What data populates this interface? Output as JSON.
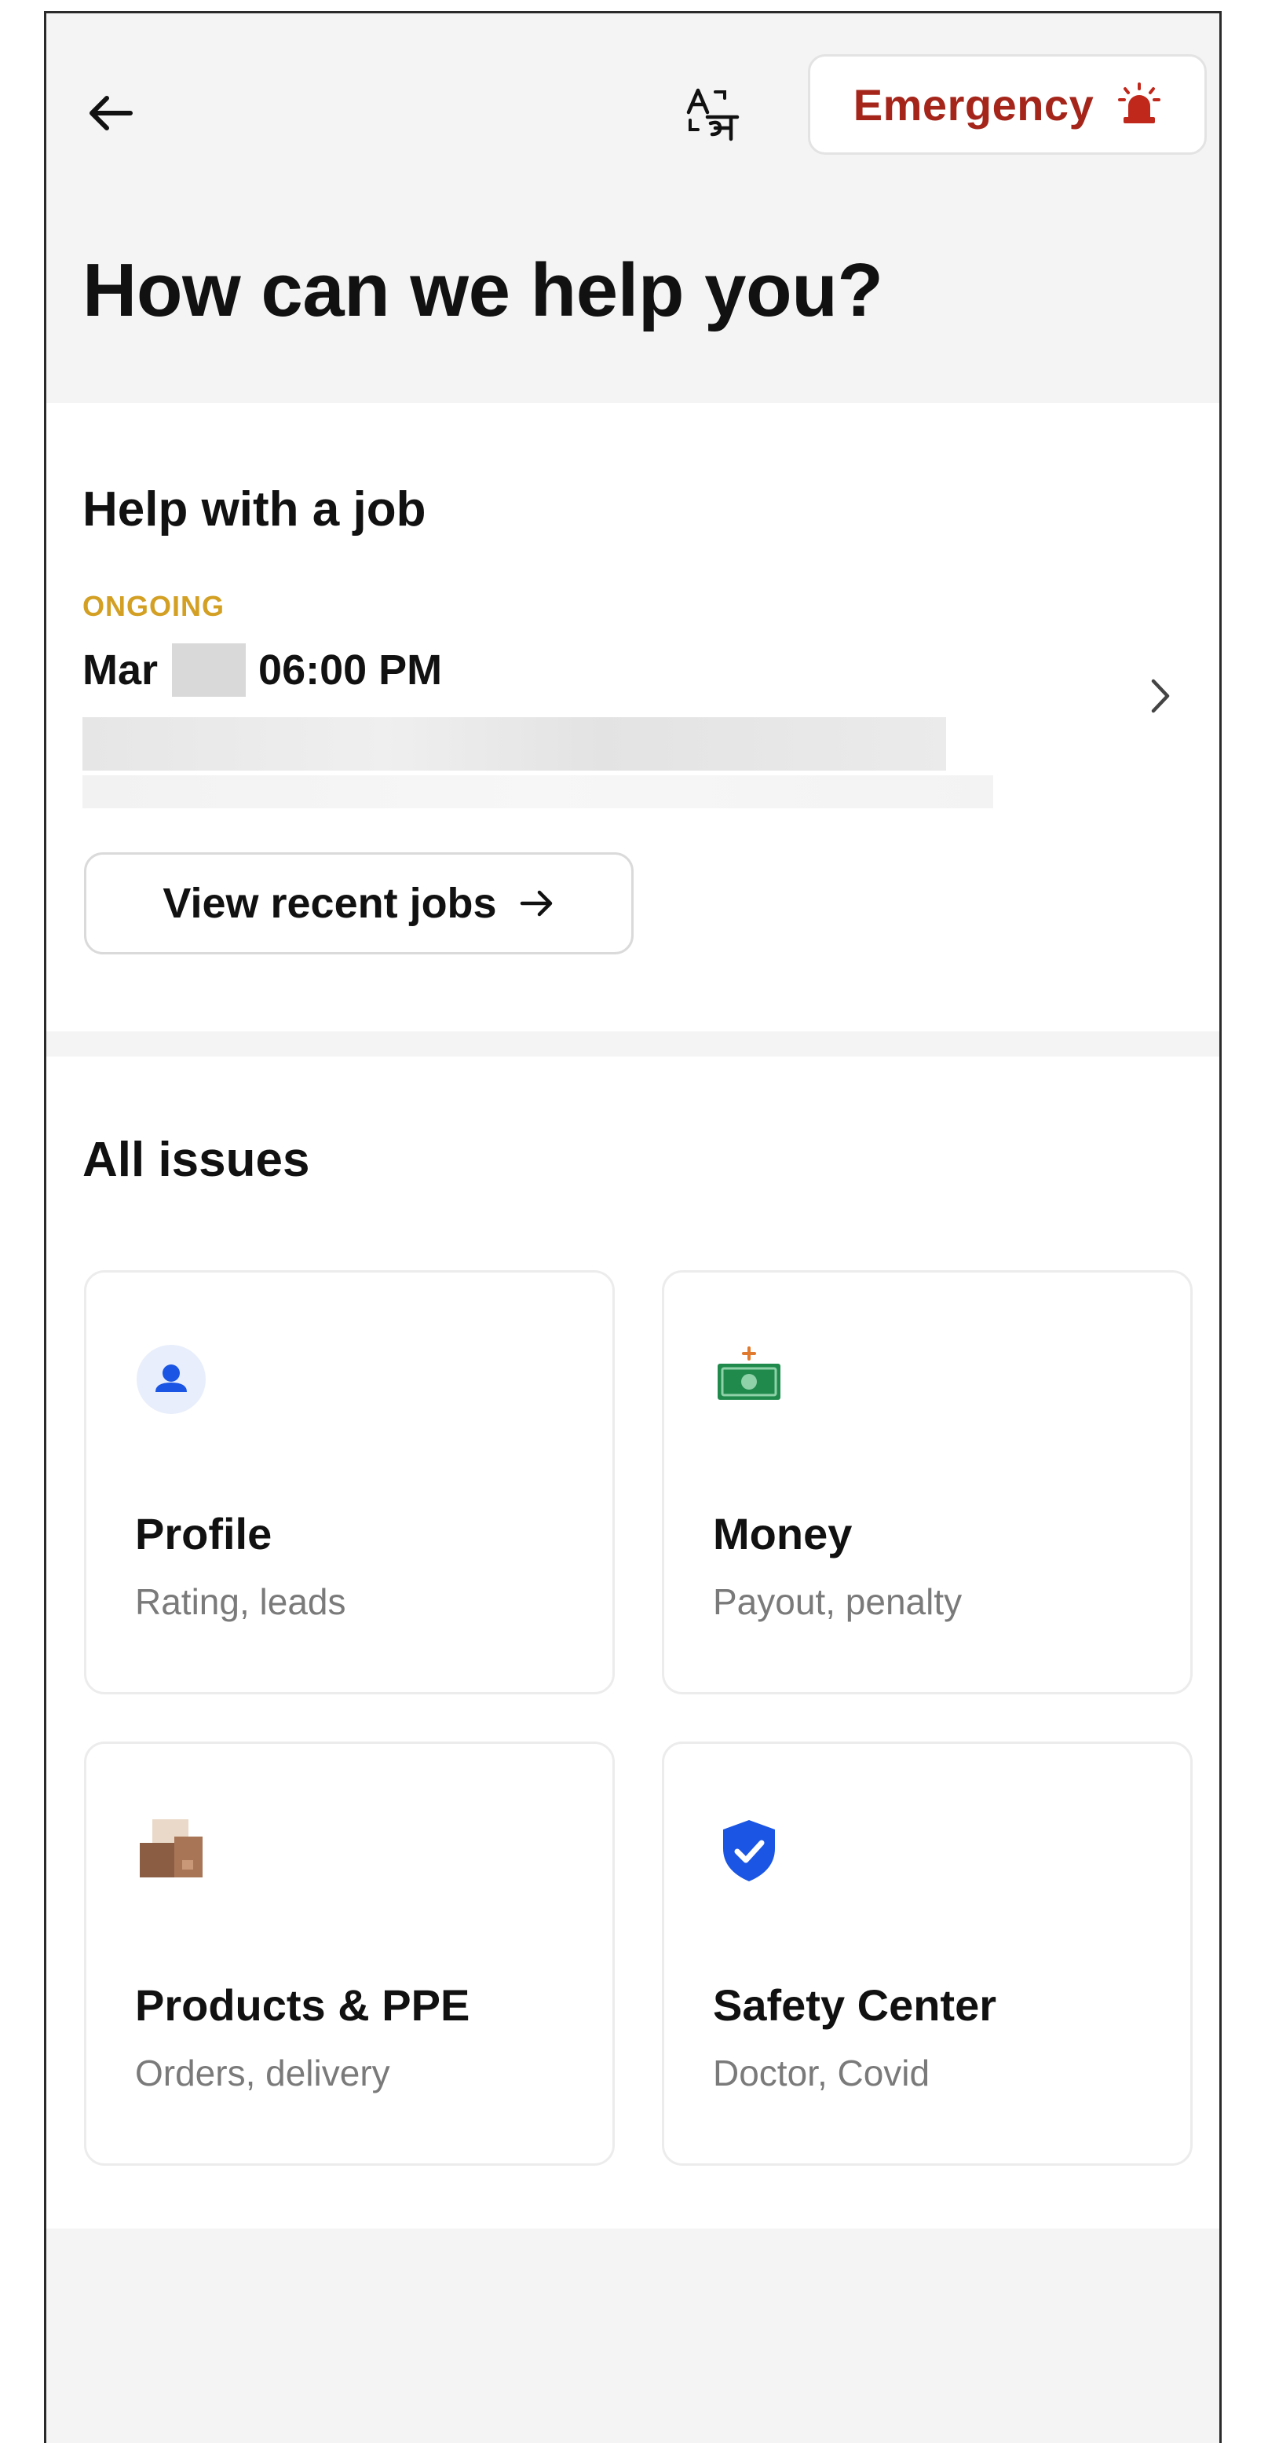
{
  "header": {
    "emergency_label": "Emergency",
    "title": "How can we help you?"
  },
  "job_section": {
    "title": "Help with a job",
    "job": {
      "status": "ONGOING",
      "month": "Mar",
      "time": "06:00 PM"
    },
    "recent_jobs_label": "View recent jobs"
  },
  "issues_section": {
    "title": "All issues",
    "cards": [
      {
        "title": "Profile",
        "subtitle": "Rating, leads",
        "icon": "profile-icon"
      },
      {
        "title": "Money",
        "subtitle": "Payout, penalty",
        "icon": "money-icon"
      },
      {
        "title": "Products & PPE",
        "subtitle": "Orders, delivery",
        "icon": "products-box-icon"
      },
      {
        "title": "Safety Center",
        "subtitle": "Doctor, Covid",
        "icon": "shield-check-icon"
      }
    ]
  },
  "colors": {
    "emergency": "#a5251b",
    "ongoing": "#d3a024",
    "accent_blue": "#1a55e3",
    "money_green": "#1f8a4c"
  }
}
